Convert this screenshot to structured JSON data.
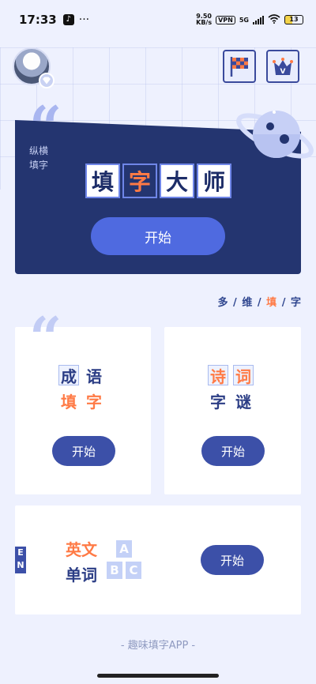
{
  "status_bar": {
    "time": "17:33",
    "net_speed_value": "9.50",
    "net_speed_unit": "KB/s",
    "vpn": "VPN",
    "network": "5G",
    "battery": "13",
    "more": "···"
  },
  "hero": {
    "subtitle_line1": "纵横",
    "subtitle_line2": "填字",
    "title_chars": [
      "填",
      "字",
      "大",
      "师"
    ],
    "start_label": "开始"
  },
  "tagline": {
    "parts": [
      "多",
      " / ",
      "维",
      " / ",
      "填",
      " / ",
      "字"
    ]
  },
  "cards": {
    "idiom": {
      "row1": [
        "成",
        "语"
      ],
      "row2": [
        "填",
        "字"
      ],
      "start_label": "开始"
    },
    "poem": {
      "row1": [
        "诗",
        "词"
      ],
      "row2": [
        "字",
        "谜"
      ],
      "start_label": "开始"
    },
    "english": {
      "en_badge_1": "E",
      "en_badge_2": "N",
      "line1": "英文",
      "line2": "单词",
      "tiles": [
        "A",
        "B",
        "C"
      ],
      "start_label": "开始"
    }
  },
  "footer": {
    "text": "- 趣味填字APP -"
  },
  "colors": {
    "background": "#eef1fe",
    "hero_bg": "#243570",
    "accent_orange": "#ff7a45",
    "button_blue": "#4f6ae0",
    "card_button": "#3c50a8"
  }
}
